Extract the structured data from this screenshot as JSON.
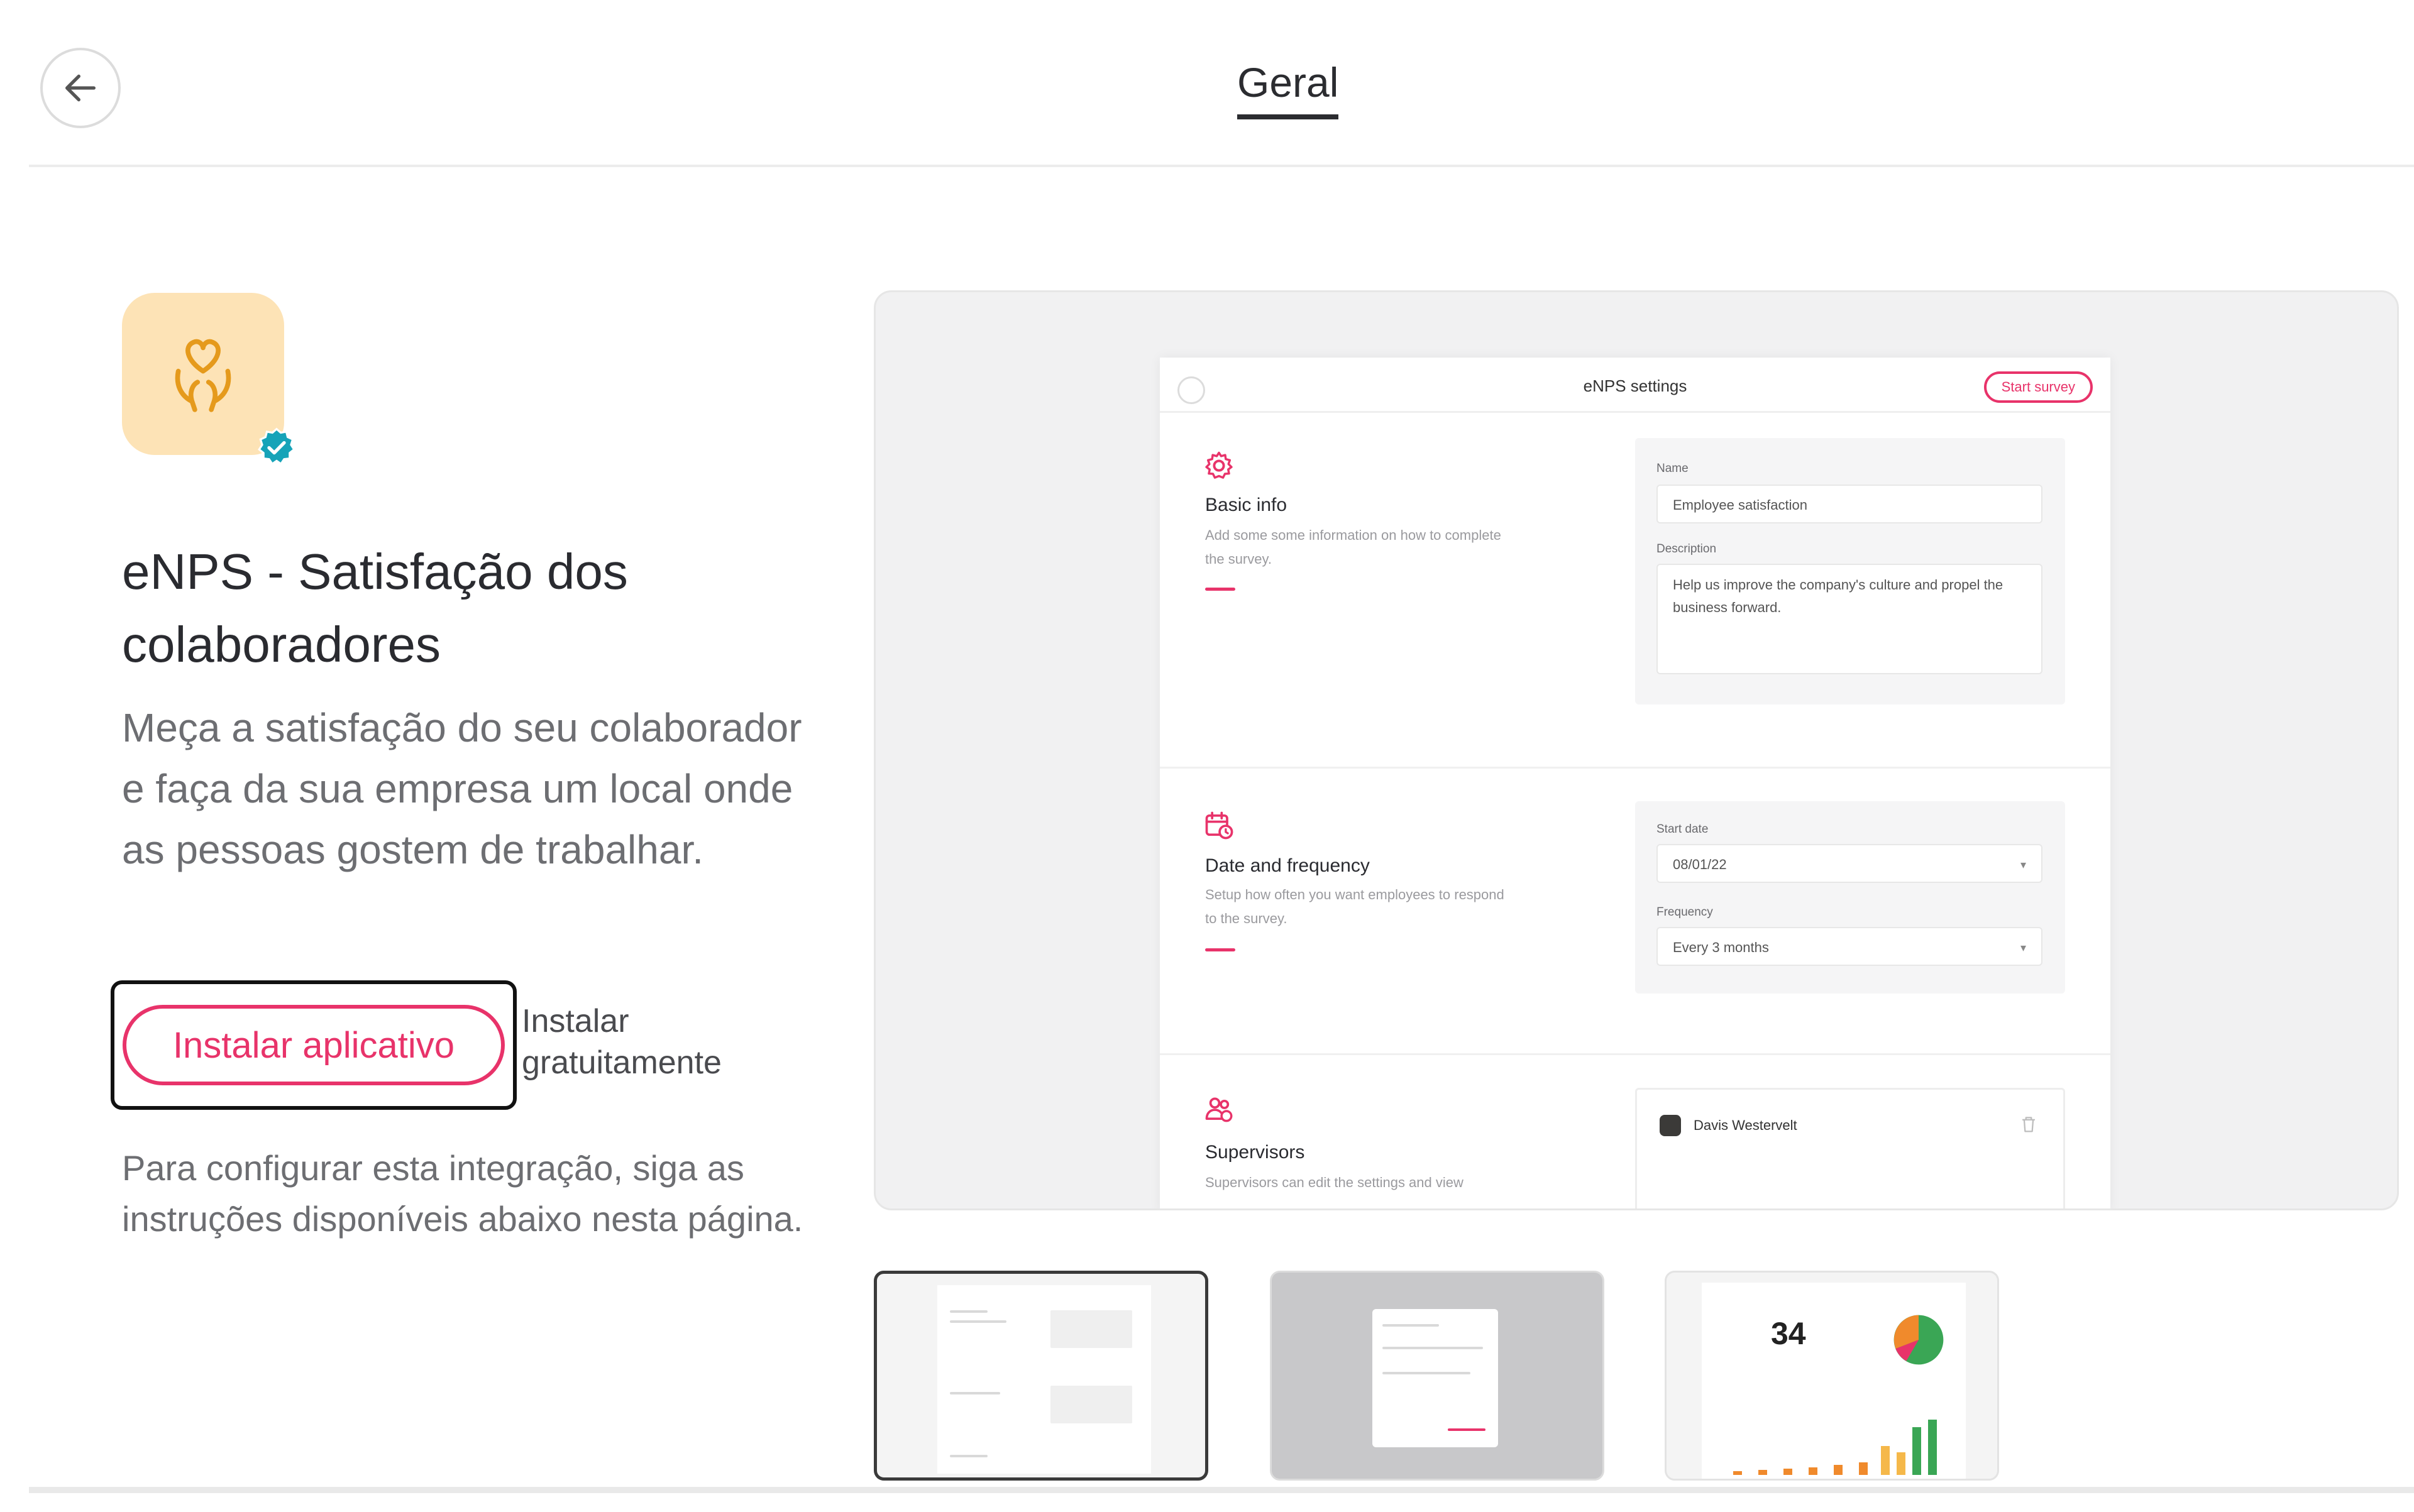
{
  "header": {
    "back_icon": "arrow-left-icon",
    "tab_title": "Geral"
  },
  "app": {
    "icon": "heart-hands-icon",
    "verified_icon": "verified-badge-icon",
    "title": "eNPS - Satisfação dos colaboradores",
    "description": "Meça a satisfação do seu colaborador e faça da sua empresa um local onde as pessoas gostem de trabalhar.",
    "install_button": "Instalar aplicativo",
    "install_free": "Instalar gratuitamente",
    "config_text": "Para configurar esta integração, siga as instruções disponíveis abaixo nesta página."
  },
  "preview": {
    "title": "eNPS settings",
    "start_button": "Start survey",
    "basic": {
      "title": "Basic info",
      "desc": "Add some some information on how to complete the survey.",
      "name_label": "Name",
      "name_value": "Employee satisfaction",
      "desc_label": "Description",
      "desc_value": "Help us improve the company's culture and propel the business forward."
    },
    "date": {
      "title": "Date and frequency",
      "desc": "Setup how often you want employees to respond to the survey.",
      "start_label": "Start date",
      "start_value": "08/01/22",
      "freq_label": "Frequency",
      "freq_value": "Every 3 months"
    },
    "supervisors": {
      "title": "Supervisors",
      "desc": "Supervisors can edit the settings and view",
      "person": "Davis Westervelt"
    }
  },
  "thumbnails": {
    "third_value": "34"
  },
  "colors": {
    "accent": "#e8336a",
    "icon_bg": "#fde3b6",
    "icon_fg": "#e59a1c",
    "verified": "#16a3b8"
  }
}
